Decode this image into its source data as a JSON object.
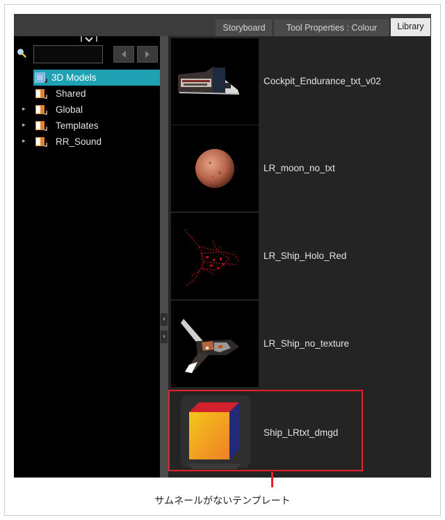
{
  "tabs": [
    {
      "label": "Storyboard",
      "active": false
    },
    {
      "label": "Tool Properties : Colour",
      "active": false
    },
    {
      "label": "Library",
      "active": true
    }
  ],
  "search": {
    "value": "",
    "placeholder": ""
  },
  "tree": {
    "items": [
      {
        "label": "3D Models",
        "expandable": false,
        "selected": true
      },
      {
        "label": "Shared",
        "expandable": false,
        "selected": false
      },
      {
        "label": "Global",
        "expandable": true,
        "selected": false
      },
      {
        "label": "Templates",
        "expandable": true,
        "selected": false
      },
      {
        "label": "RR_Sound",
        "expandable": true,
        "selected": false
      }
    ]
  },
  "library_items": [
    {
      "label": "Cockpit_Endurance_txt_v02",
      "thumbnail": "cockpit-model-thumbnail"
    },
    {
      "label": "LR_moon_no_txt",
      "thumbnail": "moon-sphere-thumbnail"
    },
    {
      "label": "LR_Ship_Holo_Red",
      "thumbnail": "hologram-ship-thumbnail"
    },
    {
      "label": "LR_Ship_no_texture",
      "thumbnail": "ship-model-thumbnail"
    },
    {
      "label": "Ship_LRtxt_dmgd",
      "thumbnail": "generic-3d-cube-icon"
    }
  ],
  "annotation": {
    "caption": "サムネールがないテンプレート",
    "highlight_color": "#e8202a"
  },
  "colors": {
    "selection": "#1fa1b3",
    "panel_background": "#000000",
    "tab_active": "#e9e9e9"
  }
}
